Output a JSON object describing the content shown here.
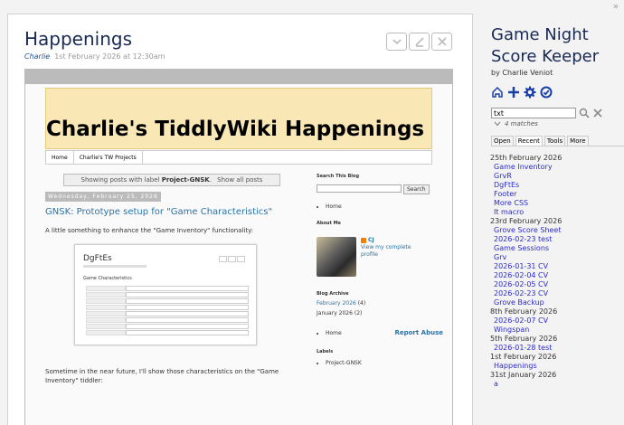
{
  "tiddler": {
    "title": "Happenings",
    "modifier": "Charlie",
    "date": "1st February 2026 at 12:30am"
  },
  "blog": {
    "banner_title": "Charlie's TiddlyWiki Happenings",
    "nav": [
      "Home",
      "Charlie's TW Projects"
    ],
    "showing_prefix": "Showing posts with label ",
    "showing_label": "Project-GNSK",
    "showing_suffix": ". ",
    "show_all": "Show all posts",
    "date_header": "Wednesday, February 25, 2026",
    "post_title": "GNSK: Prototype setup for \"Game Characteristics\"",
    "intro": "A little something to enhance the \"Game Inventory\" functionality:",
    "mini_title": "DgFtEs",
    "mini_heading": "Game Characteristics",
    "outro": "Sometime in the near future, I'll show those characteristics on the \"Game Inventory\" tiddler:",
    "search_heading": "Search This Blog",
    "search_button": "Search",
    "home": "Home",
    "about_heading": "About Me",
    "about_name": "CJ",
    "about_profile": "View my complete profile",
    "archive_heading": "Blog Archive",
    "archive": [
      {
        "month": "February 2026",
        "count": "(4)"
      },
      {
        "month": "January 2026",
        "count": "(2)"
      }
    ],
    "report": "Report Abuse",
    "labels_heading": "Labels",
    "label_item": "Project-GNSK"
  },
  "sidebar": {
    "title": "Game Night Score Keeper",
    "subtitle": "by Charlie Veniot",
    "search_value": "txt",
    "matches": "4 matches",
    "tabs": [
      "Open",
      "Recent",
      "Tools",
      "More"
    ],
    "recent": [
      {
        "date": "25th February 2026",
        "items": [
          "Game Inventory",
          "GrvR",
          "DgFtEs",
          "Footer",
          "More CSS",
          "It macro"
        ]
      },
      {
        "date": "23rd February 2026",
        "items": [
          "Grove Score Sheet",
          "2026-02-23 test",
          "Game Sessions",
          "Grv",
          "2026-01-31 CV",
          "2026-02-04 CV",
          "2026-02-05 CV",
          "2026-02-23 CV",
          "Grove Backup"
        ]
      },
      {
        "date": "8th February 2026",
        "items": [
          "2026-02-07 CV",
          "Wingspan"
        ]
      },
      {
        "date": "5th February 2026",
        "items": [
          "2026-01-28 test"
        ]
      },
      {
        "date": "1st February 2026",
        "items": [
          "Happenings"
        ]
      },
      {
        "date": "31st January 2026",
        "items": [
          "a"
        ]
      }
    ]
  },
  "colors": {
    "accent": "#182955",
    "link": "#2b2bcc",
    "banner": "#f9e8b6"
  }
}
